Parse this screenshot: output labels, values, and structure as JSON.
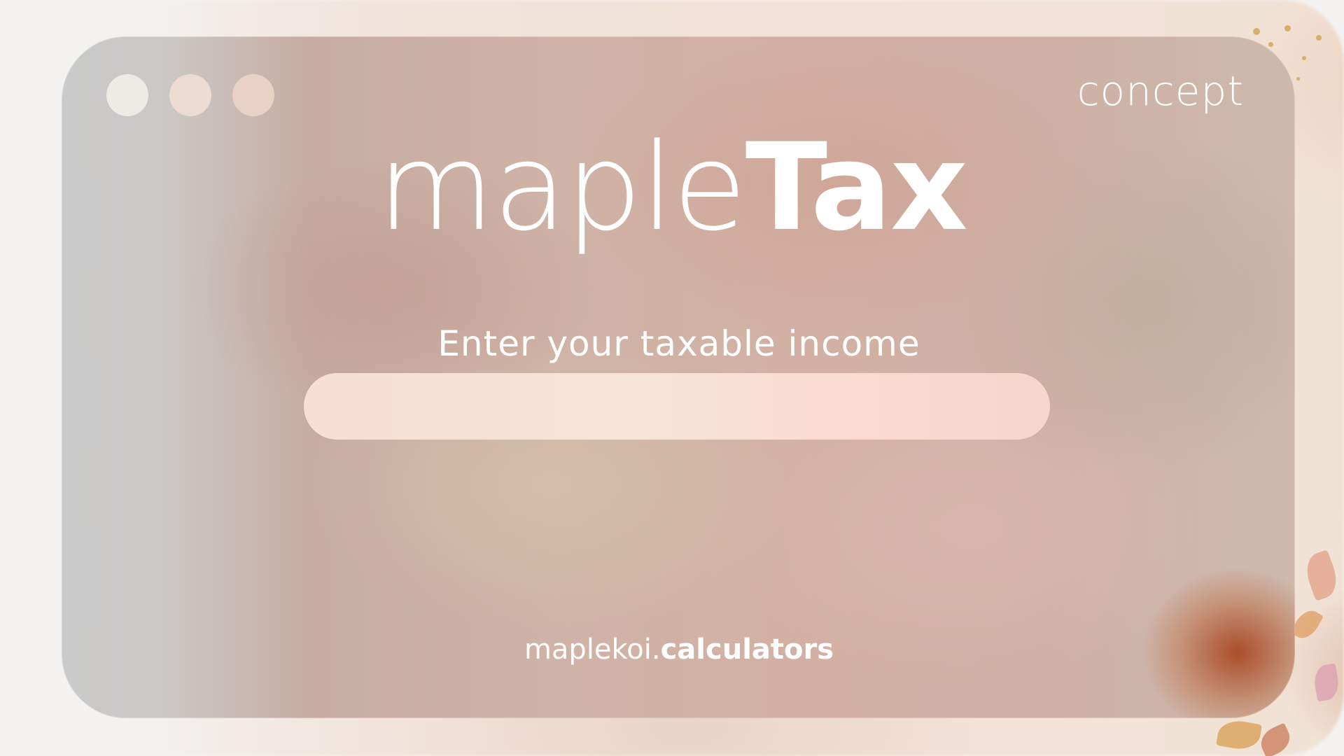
{
  "window": {
    "controls": [
      "close",
      "minimize",
      "maximize"
    ]
  },
  "header": {
    "tag": "concept"
  },
  "brand": {
    "light": "maple",
    "bold": "Tax"
  },
  "form": {
    "prompt": "Enter your taxable income",
    "income_value": "",
    "income_placeholder": ""
  },
  "footer": {
    "light": "maplekoi.",
    "bold": "calculators"
  },
  "colors": {
    "text": "#ffffff",
    "accent_orange": "#a8482a",
    "input_fill": "#f6e2d6"
  }
}
